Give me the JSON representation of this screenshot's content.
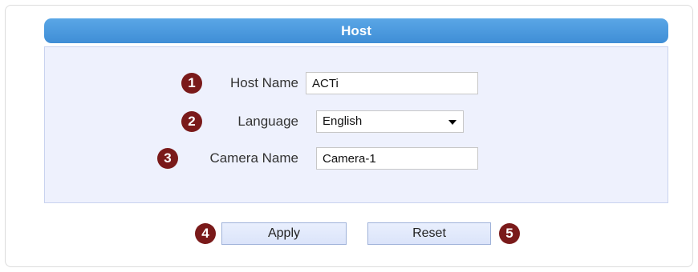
{
  "panel": {
    "title": "Host"
  },
  "fields": {
    "host_name": {
      "badge": "1",
      "label": "Host Name",
      "value": "ACTi"
    },
    "language": {
      "badge": "2",
      "label": "Language",
      "value": "English"
    },
    "camera_name": {
      "badge": "3",
      "label": "Camera Name",
      "value": "Camera-1"
    }
  },
  "buttons": {
    "apply": {
      "badge": "4",
      "label": "Apply"
    },
    "reset": {
      "badge": "5",
      "label": "Reset"
    }
  },
  "colors": {
    "header": "#4a9be0",
    "panel_bg": "#eef1fd",
    "badge": "#7a1a1a",
    "button_bg": "#dfe7fb"
  }
}
